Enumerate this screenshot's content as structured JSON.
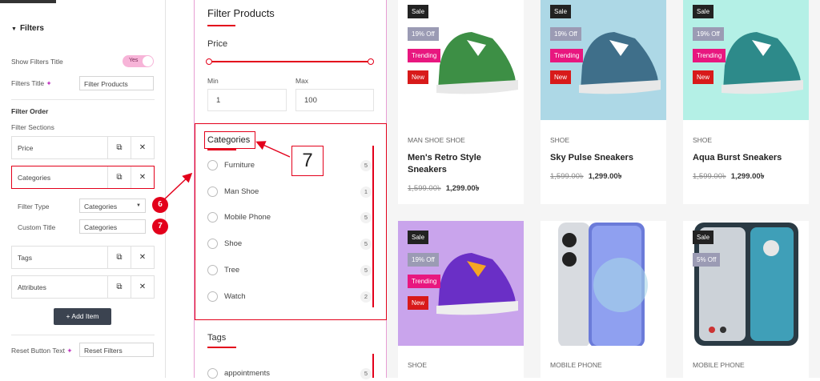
{
  "panel": {
    "section_title": "Filters",
    "show_filters_title_label": "Show Filters Title",
    "show_filters_title_toggle": "Yes",
    "filters_title_label": "Filters Title",
    "filters_title_value": "Filter Products",
    "filter_order_heading": "Filter Order",
    "filter_sections_label": "Filter Sections",
    "items": [
      {
        "label": "Price"
      },
      {
        "label": "Categories"
      },
      {
        "label": "Tags"
      },
      {
        "label": "Attributes"
      }
    ],
    "filter_type_label": "Filter Type",
    "filter_type_value": "Categories",
    "custom_title_label": "Custom Title",
    "custom_title_value": "Categories",
    "add_item_label": "Add Item",
    "reset_button_text_label": "Reset Button Text",
    "reset_button_text_value": "Reset Filters"
  },
  "callouts": {
    "b6": "6",
    "b7": "7",
    "big7": "7"
  },
  "filter": {
    "title": "Filter Products",
    "price_heading": "Price",
    "min_label": "Min",
    "max_label": "Max",
    "min_value": "1",
    "max_value": "100",
    "categories_heading": "Categories",
    "categories": [
      {
        "name": "Furniture",
        "count": "5"
      },
      {
        "name": "Man Shoe",
        "count": "1"
      },
      {
        "name": "Mobile Phone",
        "count": "5"
      },
      {
        "name": "Shoe",
        "count": "5"
      },
      {
        "name": "Tree",
        "count": "5"
      },
      {
        "name": "Watch",
        "count": "2"
      }
    ],
    "tags_heading": "Tags",
    "tags": [
      {
        "name": "appointments",
        "count": "5"
      }
    ]
  },
  "products": [
    {
      "sale": "Sale",
      "off": "19% Off",
      "trending": "Trending",
      "new": "New",
      "category": "MAN SHOE   SHOE",
      "name": "Men's Retro Style Sneakers",
      "old_price": "1,599.00৳",
      "price": "1,299.00৳",
      "bg": "#ffffff",
      "shoe": "green"
    },
    {
      "sale": "Sale",
      "off": "19% Off",
      "trending": "Trending",
      "new": "New",
      "category": "SHOE",
      "name": "Sky Pulse Sneakers",
      "old_price": "1,599.00৳",
      "price": "1,299.00৳",
      "bg": "#add8e6",
      "shoe": "blue"
    },
    {
      "sale": "Sale",
      "off": "19% Off",
      "trending": "Trending",
      "new": "New",
      "category": "SHOE",
      "name": "Aqua Burst Sneakers",
      "old_price": "1,599.00৳",
      "price": "1,299.00৳",
      "bg": "#b4f0e6",
      "shoe": "teal"
    },
    {
      "sale": "Sale",
      "off": "19% Off",
      "trending": "Trending",
      "new": "New",
      "category": "SHOE",
      "bg": "#c9a4ec",
      "shoe": "purple"
    },
    {
      "category": "MOBILE PHONE",
      "bg": "#ffffff",
      "shoe": "phone"
    },
    {
      "sale": "Sale",
      "off": "5% Off",
      "category": "MOBILE PHONE",
      "bg": "#ffffff",
      "shoe": "phone2"
    }
  ],
  "colors": {
    "accent_red": "#e3001b",
    "pink_border": "#e79ed3",
    "toggle_pink": "#e8177f"
  }
}
